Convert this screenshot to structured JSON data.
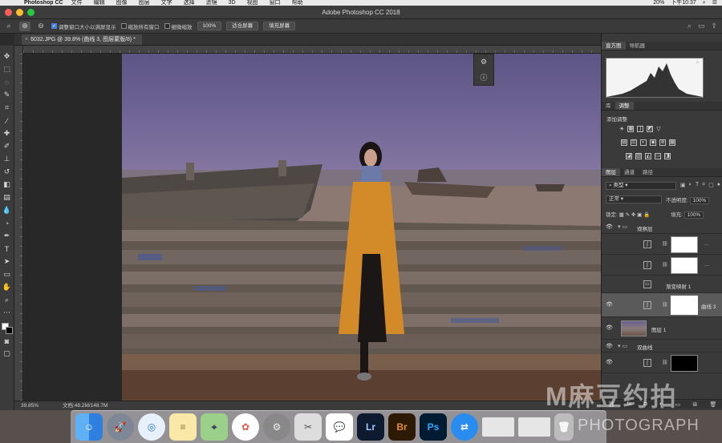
{
  "menubar": {
    "app_name": "Photoshop CC",
    "items": [
      "文件",
      "编辑",
      "图像",
      "图层",
      "文字",
      "选择",
      "滤镜",
      "3D",
      "视图",
      "窗口",
      "帮助"
    ],
    "battery": "20%",
    "clock": "下午10:37"
  },
  "window": {
    "title": "Adobe Photoshop CC 2018"
  },
  "options": {
    "resize_windows_label": "调整窗口大小以满屏显示",
    "zoom_all_label": "缩放所有窗口",
    "scrubby_zoom_label": "细微缩放",
    "btn_100": "100%",
    "btn_fit": "适合屏幕",
    "btn_fill": "填充屏幕"
  },
  "document": {
    "tab_title": "6032.JPG @ 39.8% (曲线 3, 图层蒙版/8) *"
  },
  "status": {
    "zoom": "39.85%",
    "doc_info": "文档:48.2M/148.7M"
  },
  "panels": {
    "top_tabs": [
      "直方图",
      "导航器"
    ],
    "mid_tabs": [
      "库",
      "调整"
    ],
    "adjust_title": "添加调整",
    "layer_tabs": [
      "图层",
      "通道",
      "路径"
    ],
    "filter_kind": "类型",
    "blend_mode": "正常",
    "opacity_label": "不透明度:",
    "opacity_value": "100%",
    "lock_label": "锁定:",
    "fill_label": "填充:",
    "fill_value": "100%"
  },
  "layers": [
    {
      "name": "观察层",
      "type": "group"
    },
    {
      "name": "",
      "type": "curve"
    },
    {
      "name": "",
      "type": "curve"
    },
    {
      "name": "渐变映射 1",
      "type": "gradient"
    },
    {
      "name": "曲线 3",
      "type": "curve",
      "selected": true
    },
    {
      "name": "图层 1",
      "type": "image"
    },
    {
      "name": "双曲线",
      "type": "group"
    },
    {
      "name": "",
      "type": "curve-black"
    }
  ],
  "dock": {
    "apps": [
      "Finder",
      "Launchpad",
      "Safari",
      "Notes",
      "Maps",
      "Photos",
      "System Preferences",
      "Preview",
      "WeChat",
      "Lr",
      "Br",
      "Ps",
      "TeamViewer"
    ]
  },
  "watermark": {
    "line1": "M麻豆约拍",
    "line2": "PHOTOGRAPH"
  },
  "colors": {
    "ps_blue": "#31a8ff",
    "br_orange": "#e58d2a",
    "lr_blue": "#a4c5ff"
  }
}
